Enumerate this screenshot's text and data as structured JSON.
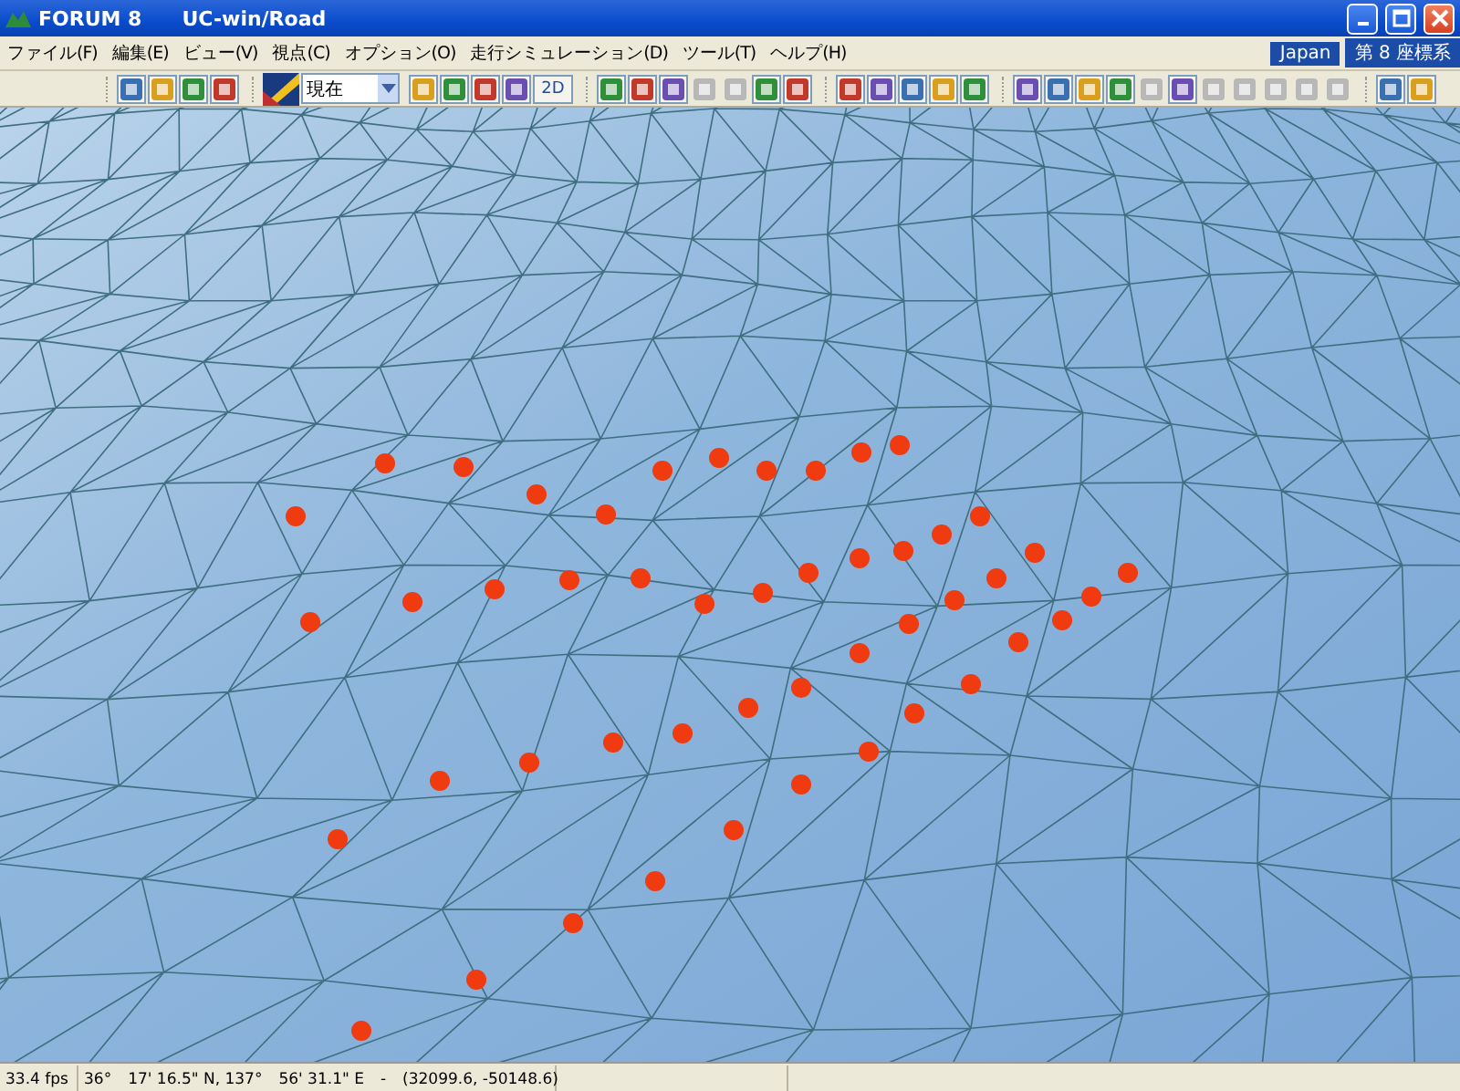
{
  "window": {
    "title_app": "FORUM 8",
    "title": "UC-win/Road"
  },
  "menu": [
    "ファイル(F)",
    "編集(E)",
    "ビュー(V)",
    "視点(C)",
    "オプション(O)",
    "走行シミュレーション(D)",
    "ツール(T)",
    "ヘルプ(H)"
  ],
  "region": {
    "country": "Japan",
    "coordinate_system": "第 8 座標系"
  },
  "toolbar": {
    "groups": [
      {
        "buttons": [
          {
            "disabled": false
          },
          {
            "disabled": false
          },
          {
            "disabled": false
          },
          {
            "disabled": false
          }
        ]
      },
      {
        "dropdown": {
          "value": "現在"
        },
        "buttons": [
          {
            "disabled": false
          },
          {
            "disabled": false
          },
          {
            "disabled": false
          },
          {
            "disabled": false
          }
        ],
        "text_button": "2D"
      },
      {
        "buttons": [
          {
            "disabled": false
          },
          {
            "disabled": false
          },
          {
            "disabled": false
          },
          {
            "disabled": true
          },
          {
            "disabled": true
          },
          {
            "disabled": false
          },
          {
            "disabled": false
          }
        ]
      },
      {
        "buttons": [
          {
            "disabled": false
          },
          {
            "disabled": false
          },
          {
            "disabled": false
          },
          {
            "disabled": false
          },
          {
            "disabled": false
          }
        ]
      },
      {
        "buttons": [
          {
            "disabled": false
          },
          {
            "disabled": false
          },
          {
            "disabled": false
          },
          {
            "disabled": false
          },
          {
            "disabled": true
          },
          {
            "disabled": false
          },
          {
            "disabled": true
          },
          {
            "disabled": true
          },
          {
            "disabled": true
          },
          {
            "disabled": true
          },
          {
            "disabled": true
          }
        ]
      },
      {
        "buttons": [
          {
            "disabled": false
          },
          {
            "disabled": false
          }
        ]
      }
    ]
  },
  "status_bar": {
    "fps": "33.4 fps",
    "position": "36°　17' 16.5\" N, 137°　56' 31.1\" E　-　(32099.6, -50148.6)"
  }
}
